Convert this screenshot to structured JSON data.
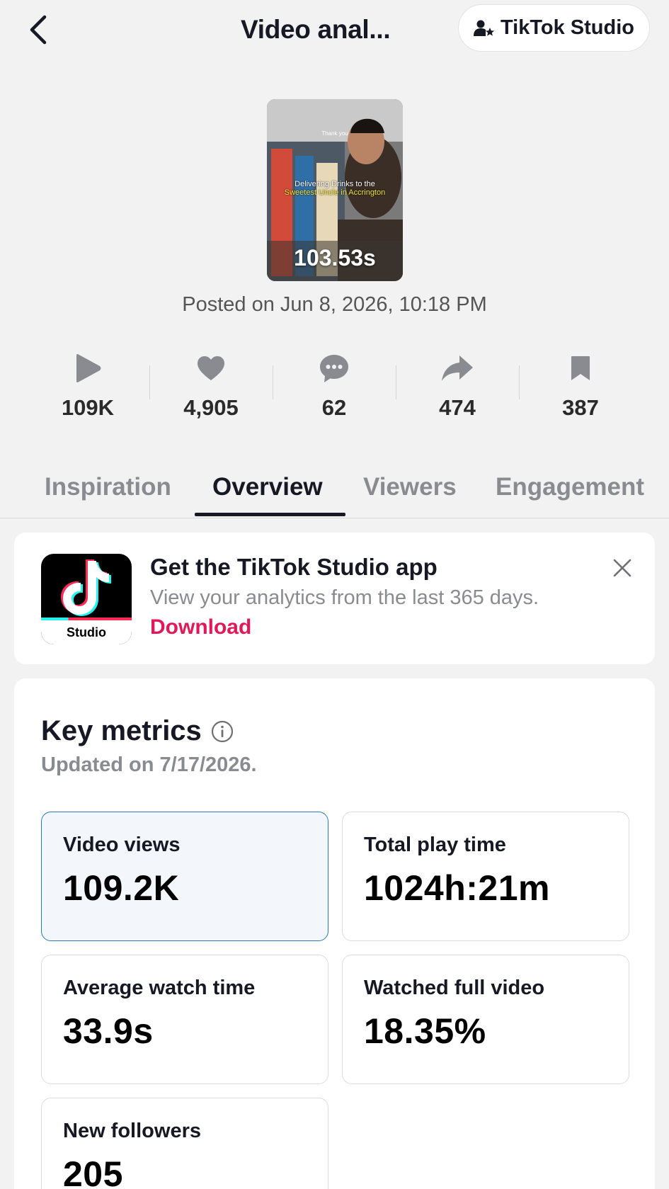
{
  "header": {
    "title": "Video anal...",
    "studio_button_label": "TikTok Studio"
  },
  "video": {
    "caption_top": "Thank you",
    "caption_line1": "Delivering Drinks to the",
    "caption_line2": "Sweetest Uncle in Accrington",
    "duration": "103.53s",
    "posted": "Posted on Jun 8, 2026, 10:18 PM"
  },
  "stats": [
    {
      "icon": "play-icon",
      "value": "109K"
    },
    {
      "icon": "heart-icon",
      "value": "4,905"
    },
    {
      "icon": "comment-icon",
      "value": "62"
    },
    {
      "icon": "share-icon",
      "value": "474"
    },
    {
      "icon": "bookmark-icon",
      "value": "387"
    }
  ],
  "tabs": [
    {
      "label": "Inspiration",
      "active": false
    },
    {
      "label": "Overview",
      "active": true
    },
    {
      "label": "Viewers",
      "active": false
    },
    {
      "label": "Engagement",
      "active": false
    }
  ],
  "banner": {
    "icon_label": "Studio",
    "title": "Get the TikTok Studio app",
    "subtitle": "View your analytics from the last 365 days.",
    "link": "Download"
  },
  "key_metrics": {
    "title": "Key metrics",
    "updated": "Updated on 7/17/2026.",
    "items": [
      {
        "label": "Video views",
        "value": "109.2K",
        "selected": true
      },
      {
        "label": "Total play time",
        "value": "1024h:21m",
        "selected": false
      },
      {
        "label": "Average watch time",
        "value": "33.9s",
        "selected": false
      },
      {
        "label": "Watched full video",
        "value": "18.35%",
        "selected": false
      },
      {
        "label": "New followers",
        "value": "205",
        "selected": false
      }
    ]
  },
  "colors": {
    "accent_link": "#e0195a",
    "selected_border": "#2a78b3",
    "selected_bg": "#f3f7fb"
  }
}
